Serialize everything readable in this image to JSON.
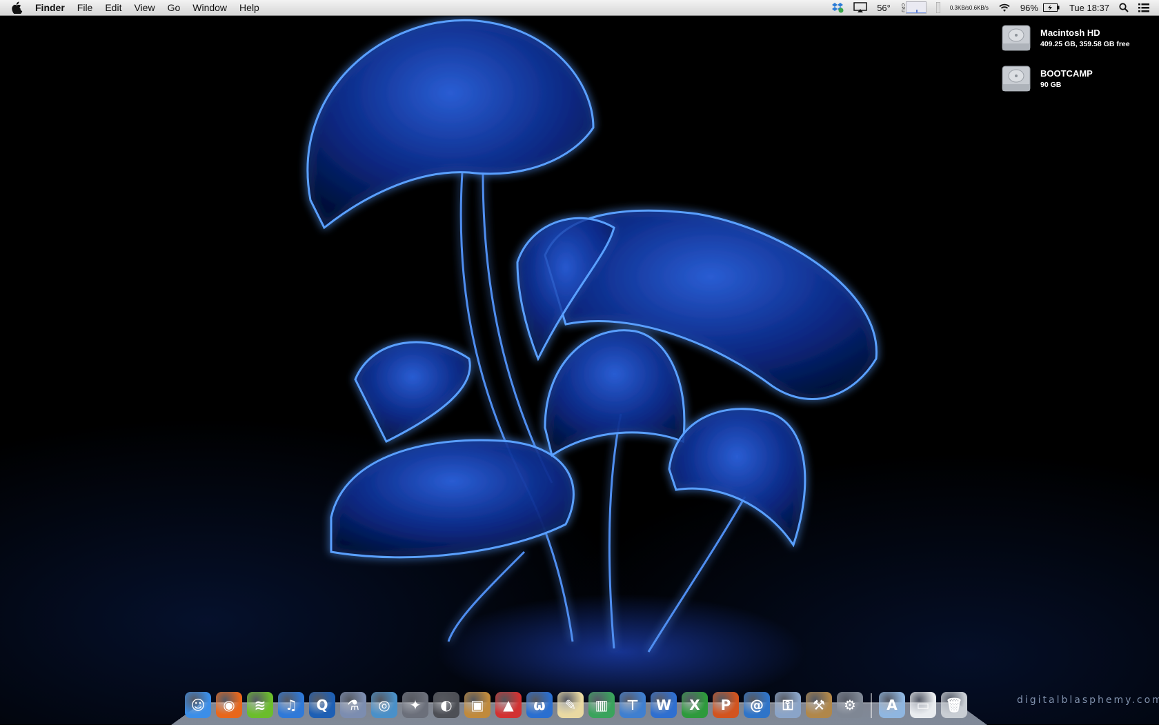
{
  "menubar": {
    "app_name": "Finder",
    "menus": [
      "File",
      "Edit",
      "View",
      "Go",
      "Window",
      "Help"
    ],
    "status": {
      "temperature": "56°",
      "net_up": "0.3KB/s",
      "net_down": "0.6KB/s",
      "cpu_label": "CPU",
      "battery": "96%",
      "clock": "Tue 18:37"
    }
  },
  "desktop": {
    "volumes": [
      {
        "name": "Macintosh HD",
        "info": "409.25 GB, 359.58 GB free"
      },
      {
        "name": "BOOTCAMP",
        "info": "90 GB"
      }
    ],
    "watermark": "digitalblasphemy.com"
  },
  "dock": {
    "apps": [
      {
        "name": "finder-icon",
        "glyph": "☺",
        "color": "#3b8ee8"
      },
      {
        "name": "firefox-icon",
        "glyph": "◉",
        "color": "#e8671c"
      },
      {
        "name": "spotify-icon",
        "glyph": "≋",
        "color": "#6bbd2c"
      },
      {
        "name": "itunes-icon",
        "glyph": "♫",
        "color": "#2f79d8"
      },
      {
        "name": "quicktime-icon",
        "glyph": "Q",
        "color": "#1e5fb4"
      },
      {
        "name": "utility-flask-icon",
        "glyph": "⚗",
        "color": "#7c8db0"
      },
      {
        "name": "preview-icon",
        "glyph": "◎",
        "color": "#4a90c8"
      },
      {
        "name": "imovie-icon",
        "glyph": "✦",
        "color": "#6b6f7a"
      },
      {
        "name": "logic-icon",
        "glyph": "◐",
        "color": "#4d4f55"
      },
      {
        "name": "iphoto-icon",
        "glyph": "▣",
        "color": "#c08a3c"
      },
      {
        "name": "sketchup-icon",
        "glyph": "▲",
        "color": "#d23232"
      },
      {
        "name": "wings-icon",
        "glyph": "ω",
        "color": "#2a6fd0"
      },
      {
        "name": "textedit-icon",
        "glyph": "✎",
        "color": "#e9d9a2"
      },
      {
        "name": "numbers-icon",
        "glyph": "▥",
        "color": "#3aa35c"
      },
      {
        "name": "keynote-icon",
        "glyph": "⊤",
        "color": "#3f7fd0"
      },
      {
        "name": "word-icon",
        "glyph": "W",
        "color": "#2f6fd0"
      },
      {
        "name": "excel-icon",
        "glyph": "X",
        "color": "#2e9a3c"
      },
      {
        "name": "powerpoint-icon",
        "glyph": "P",
        "color": "#d2541f"
      },
      {
        "name": "outlook-icon",
        "glyph": "@",
        "color": "#2f74c8"
      },
      {
        "name": "keychain-icon",
        "glyph": "⚿",
        "color": "#8aa4c8"
      },
      {
        "name": "instruments-icon",
        "glyph": "⚒",
        "color": "#b0874a"
      },
      {
        "name": "system-preferences-icon",
        "glyph": "⚙",
        "color": "#7f8794"
      }
    ],
    "others": [
      {
        "name": "applications-folder-icon",
        "glyph": "A",
        "color": "#8fb6e0"
      },
      {
        "name": "downloads-stack-icon",
        "glyph": "▭",
        "color": "#e9ecef"
      },
      {
        "name": "trash-icon",
        "glyph": "🗑",
        "color": "#c9ced4"
      }
    ]
  }
}
